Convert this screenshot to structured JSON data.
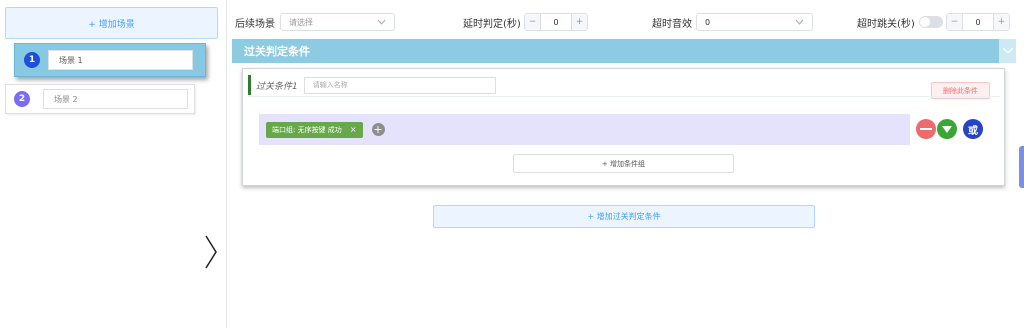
{
  "left": {
    "add_scene_label": "+ 增加场景",
    "scenes": [
      {
        "num": "1",
        "name": "场景 1"
      },
      {
        "num": "2",
        "name": "场景 2"
      }
    ]
  },
  "toolbar": {
    "next_scene_label": "后续场景",
    "next_scene_placeholder": "请选择",
    "delay_label": "延时判定(秒)",
    "delay_value": "0",
    "timeout_sound_label": "超时音效",
    "timeout_sound_value": "0",
    "timeout_jump_label": "超时跳关(秒)",
    "timeout_jump_value": "0",
    "timeout_jump_enabled": false
  },
  "section": {
    "title": "过关判定条件"
  },
  "condition": {
    "title": "过关条件1",
    "name_placeholder": "请输入名称",
    "delete_label": "删除此条件",
    "group_tag": "端口组: 无序按键 成功",
    "tag_close": "×",
    "add_item": "+",
    "or_label": "或",
    "add_group_label": "+ 增加条件组"
  },
  "add_condition_label": "+ 增加过关判定条件",
  "colors": {
    "accent": "#409eff",
    "section_bar": "#8dcbe2",
    "tag_green": "#67a84a",
    "remove_red": "#ef6a6a",
    "move_green": "#3aa635",
    "or_blue": "#2743c7"
  },
  "icons": {
    "collapse_arrow": "chevron-right-icon",
    "section_collapse": "chevron-down-icon",
    "select_chevron": "chevron-down-icon",
    "remove_group": "minus-circle-icon",
    "move_down": "triangle-down-circle-icon"
  }
}
